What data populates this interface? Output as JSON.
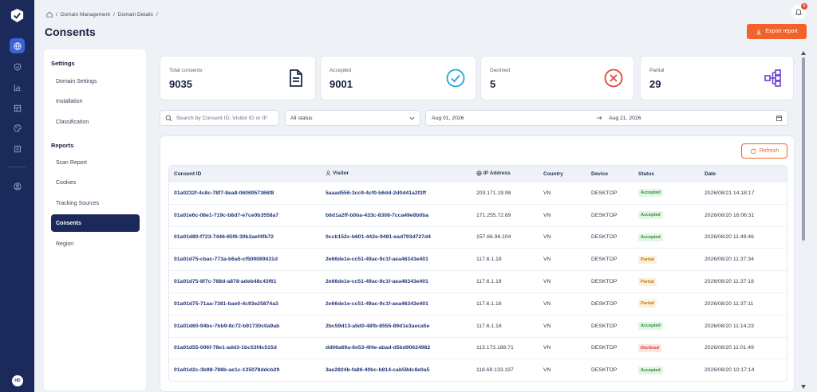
{
  "breadcrumb": {
    "items": [
      "Domain Management",
      "Domain Details"
    ],
    "sep": "/"
  },
  "page_title": "Consents",
  "notifications": {
    "count": "8"
  },
  "export_label": "Export report",
  "user": {
    "initials": "HD"
  },
  "settings_nav": {
    "heading_settings": "Settings",
    "heading_reports": "Reports",
    "settings_items": [
      "Domain Settings",
      "Installation",
      "Classification"
    ],
    "report_items": [
      "Scan Report",
      "Cookies",
      "Tracking Sources",
      "Consents",
      "Region"
    ],
    "active": "Consents"
  },
  "stats": [
    {
      "label": "Total consents",
      "value": "9035",
      "icon": "document-icon"
    },
    {
      "label": "Accepted",
      "value": "9001",
      "icon": "check-circle-icon"
    },
    {
      "label": "Declined",
      "value": "5",
      "icon": "x-circle-icon"
    },
    {
      "label": "Partial",
      "value": "29",
      "icon": "hierarchy-icon"
    }
  ],
  "filters": {
    "search_placeholder": "Search by Consent ID, Visitor ID or IP",
    "status_value": "All status",
    "date_from": "Aug 01, 2026",
    "date_to": "Aug 21, 2026"
  },
  "refresh_label": "Refresh",
  "table": {
    "headers": {
      "consent_id": "Consent ID",
      "visitor": "Visitor",
      "ip": "IP Address",
      "country": "Country",
      "device": "Device",
      "status": "Status",
      "date": "Date"
    },
    "rows": [
      {
        "id": "01a0232f-4c8c-78f7-8ea8-0606957366f8",
        "visitor": "5aaad556-3cc9-4cf0-b6dd-2d0d41a2f3ff",
        "ip": "203.171.19.98",
        "country": "VN",
        "device": "DESKTOP",
        "status": "Accepted",
        "date": "2026/08/21 14:18:17"
      },
      {
        "id": "01a01e6c-08e1-719c-b8d7-e7ce0b3558a7",
        "visitor": "b6d1a2ff-b0ba-433c-8308-7cca49e8b0ba",
        "ip": "171.255.72.69",
        "country": "VN",
        "device": "DESKTOP",
        "status": "Accepted",
        "date": "2026/08/20 16:06:31"
      },
      {
        "id": "01a01d80-f723-7446-85f6-30b2aef4fb72",
        "visitor": "0ccb152c-b601-442e-9481-ead793d727d4",
        "ip": "157.66.96.104",
        "country": "VN",
        "device": "DESKTOP",
        "status": "Accepted",
        "date": "2026/08/20 11:49:46"
      },
      {
        "id": "01a01d75-cbac-773a-b6a5-cf509089431d",
        "visitor": "2e66de1e-cc51-49ac-9c1f-aea46343e401",
        "ip": "117.6.1.18",
        "country": "VN",
        "device": "DESKTOP",
        "status": "Partial",
        "date": "2026/08/20 11:37:34"
      },
      {
        "id": "01a01d75-8f7c-788d-a878-adeb48c43f61",
        "visitor": "2e66de1e-cc51-49ac-9c1f-aea46343e401",
        "ip": "117.6.1.18",
        "country": "VN",
        "device": "DESKTOP",
        "status": "Partial",
        "date": "2026/08/20 11:37:18"
      },
      {
        "id": "01a01d75-71aa-7381-bae0-4c93e25874a3",
        "visitor": "2e66de1e-cc51-49ac-9c1f-aea46343e401",
        "ip": "117.6.1.18",
        "country": "VN",
        "device": "DESKTOP",
        "status": "Partial",
        "date": "2026/08/20 11:37:11"
      },
      {
        "id": "01a01d60-94bc-7bb9-8c72-b91730c0a9ab",
        "visitor": "2bc59d13-a5d0-48fb-8555-89d1e3aeca5e",
        "ip": "117.6.1.18",
        "country": "VN",
        "device": "DESKTOP",
        "status": "Accepted",
        "date": "2026/08/20 11:14:23"
      },
      {
        "id": "01a01d55-006f-78e1-add3-1bc53f4c515d",
        "visitor": "dd06a69a-6e53-4f4e-abad-d5bd90624982",
        "ip": "113.173.188.71",
        "country": "VN",
        "device": "DESKTOP",
        "status": "Declined",
        "date": "2026/08/20 11:01:49"
      },
      {
        "id": "01a01d2c-3b98-788b-ae1c-135078ddcb29",
        "visitor": "3ae2824b-fa86-40bc-b814-cab59dc8e0a5",
        "ip": "118.69.133.197",
        "country": "VN",
        "device": "DESKTOP",
        "status": "Accepted",
        "date": "2026/08/20 10:17:14"
      }
    ]
  },
  "colors": {
    "accent": "#f3622a",
    "rail": "#1b2a5a",
    "accepted_bg": "#e3f6e5",
    "accepted_fg": "#2f8a3c",
    "partial_bg": "#fdf0d9",
    "partial_fg": "#b9781b",
    "declined_bg": "#fde4e2",
    "declined_fg": "#c93a2e"
  }
}
